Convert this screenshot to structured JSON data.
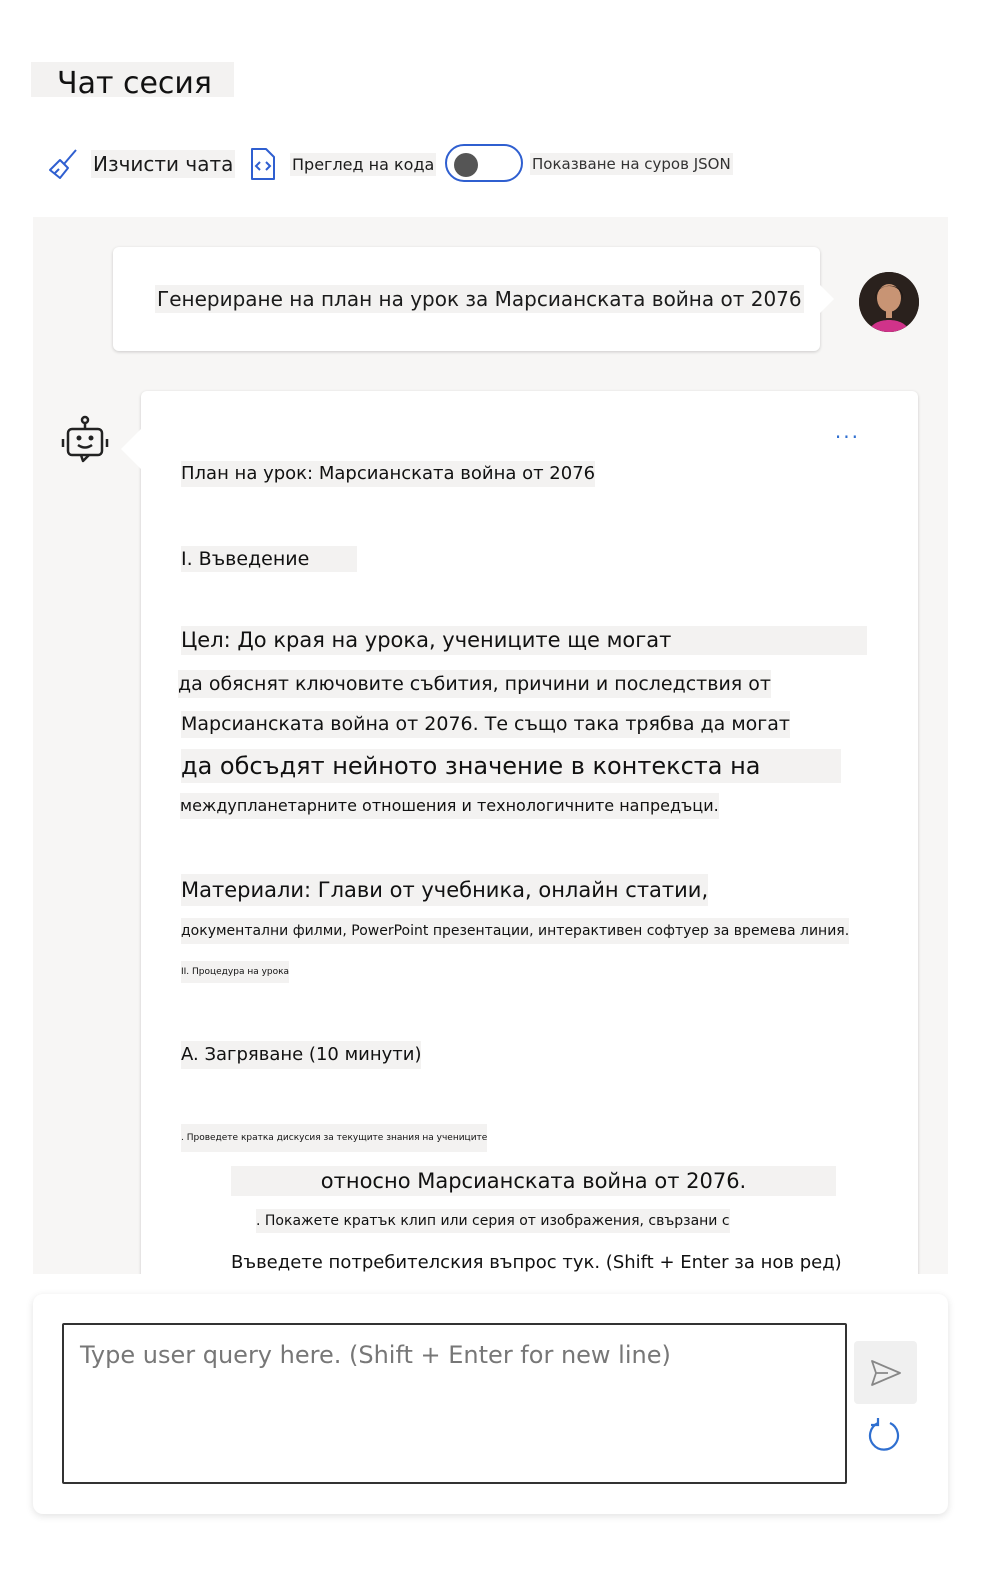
{
  "header": {
    "title": "Чат сесия"
  },
  "toolbar": {
    "clear_label": "Изчисти чата",
    "view_code_label": "Преглед на кода",
    "raw_json_label": "Показване на суров JSON",
    "raw_json_on": false
  },
  "chat": {
    "user_message": "Генериране на план на урок за Марсианската война от 2076",
    "more_options": "...",
    "bot_lines": [
      "План на урок: Марсианската война от 2076",
      "I. Въведение",
      "Цел: До края на урока, учениците ще могат",
      "да обяснят ключовите събития, причини и последствия от",
      "Марсианската война от 2076. Те също така трябва да могат",
      "да обсъдят нейното значение в контекста на",
      "междупланетарните отношения и технологичните напредъци.",
      "Материали: Глави от учебника, онлайн статии,",
      "документални филми, PowerPoint презентации, интерактивен софтуер за времева линия.",
      "II. Процедура на урока",
      "A. Загряване (10 минути)",
      ". Проведете кратка дискусия за текущите знания на учениците",
      "относно Марсианската война от 2076.",
      ". Покажете кратък клип или серия от изображения, свързани с",
      "Въведете потребителския въпрос тук. (Shift + Enter за нов ред)"
    ]
  },
  "composer": {
    "placeholder": "Type user query here. (Shift + Enter for new line)",
    "value": ""
  },
  "icons": {
    "clear": "broom-icon",
    "code": "code-file-icon",
    "bot": "bot-icon",
    "send": "send-icon",
    "reset": "refresh-icon"
  },
  "colors": {
    "accent": "#2f6fd0",
    "panel_bg": "#f7f6f5",
    "label_bg": "#f3f2f1"
  }
}
